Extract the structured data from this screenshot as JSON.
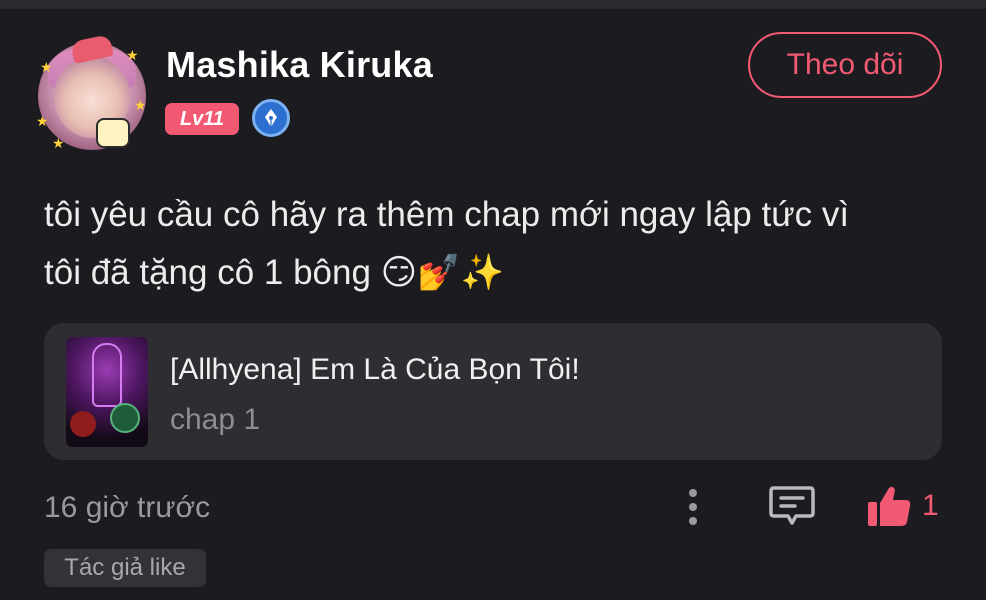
{
  "user": {
    "name": "Mashika Kiruka",
    "level": "Lv11",
    "badge_icon": "pen-nib-icon"
  },
  "follow": {
    "label": "Theo dõi"
  },
  "comment": {
    "line1": "tôi yêu cầu cô hãy ra thêm chap mới ngay lập tức vì",
    "line2": "tôi đã tặng cô 1 bông ",
    "emojis": "😏💅✨"
  },
  "linked_story": {
    "title": "[Allhyena] Em Là Của Bọn Tôi!",
    "chapter": "chap 1"
  },
  "meta": {
    "timestamp": "16 giờ trước",
    "like_count": "1",
    "author_tag": "Tác giả like"
  },
  "colors": {
    "accent": "#f25973",
    "background": "#1c1b1f",
    "card": "#2e2d31",
    "badge_blue": "#2d6fcf"
  },
  "icons": {
    "more": "more-vertical-icon",
    "reply": "comment-icon",
    "like": "thumbs-up-icon"
  }
}
